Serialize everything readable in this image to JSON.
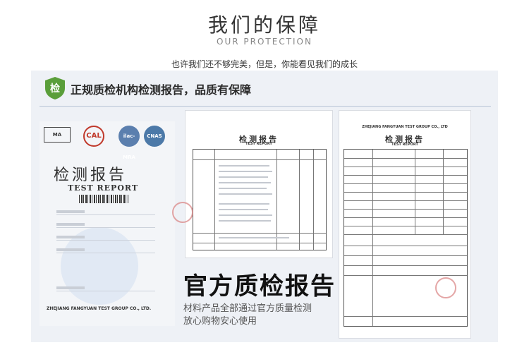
{
  "header": {
    "title": "我们的保障",
    "subtitle": "OUR PROTECTION",
    "tagline": "也许我们还不够完美，但是，你能看见我们的成长"
  },
  "banner": {
    "badge_char": "检",
    "text": "正规质检机构检测报告，品质有保障"
  },
  "cert_left": {
    "logos": [
      "MA",
      "CAL",
      "ilac-MRA",
      "CNAS"
    ],
    "title": "检测报告",
    "title_en": "TEST REPORT",
    "footer": "ZHEJIANG FANGYUAN TEST GROUP CO., LTD."
  },
  "cert_middle": {
    "title": "检测报告",
    "title_en": "TEST REPORT"
  },
  "cert_right": {
    "company": "ZHEJIANG FANGYUAN TEST GROUP CO., LTD",
    "title": "检测报告",
    "title_en": "TEST REPORT"
  },
  "promo": {
    "headline": "官方质检报告",
    "line1": "材料产品全部通过官方质量检测",
    "line2": "放心购物安心使用"
  },
  "colors": {
    "panel_bg": "#eef1f6",
    "badge_green": "#5a9e3a",
    "stamp_red": "#d98080"
  }
}
